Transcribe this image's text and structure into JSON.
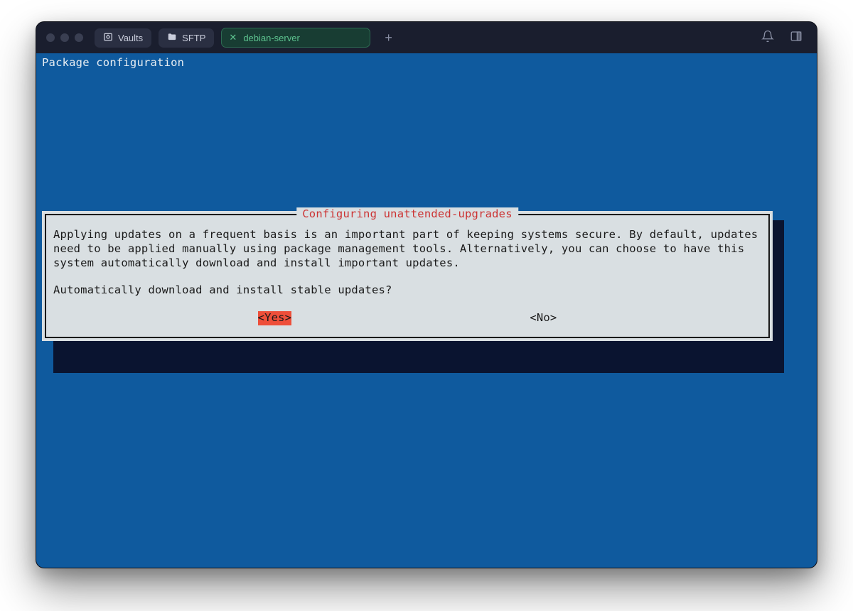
{
  "titlebar": {
    "vaults_label": "Vaults",
    "sftp_label": "SFTP",
    "active_tab": {
      "label": "debian-server"
    }
  },
  "terminal": {
    "title": "Package configuration",
    "dialog": {
      "caption": "Configuring unattended-upgrades",
      "body_text": "Applying updates on a frequent basis is an important part of keeping systems secure. By default, updates need to be applied manually using package management tools. Alternatively, you can choose to have this system automatically download and install important updates.",
      "question": "Automatically download and install stable updates?",
      "yes_label": "<Yes>",
      "no_label": "<No>"
    }
  },
  "colors": {
    "terminal_bg": "#0f5a9e",
    "dialog_bg": "#d9dfe2",
    "caption_fg": "#cc3333",
    "selected_bg": "#ee4f3a"
  }
}
